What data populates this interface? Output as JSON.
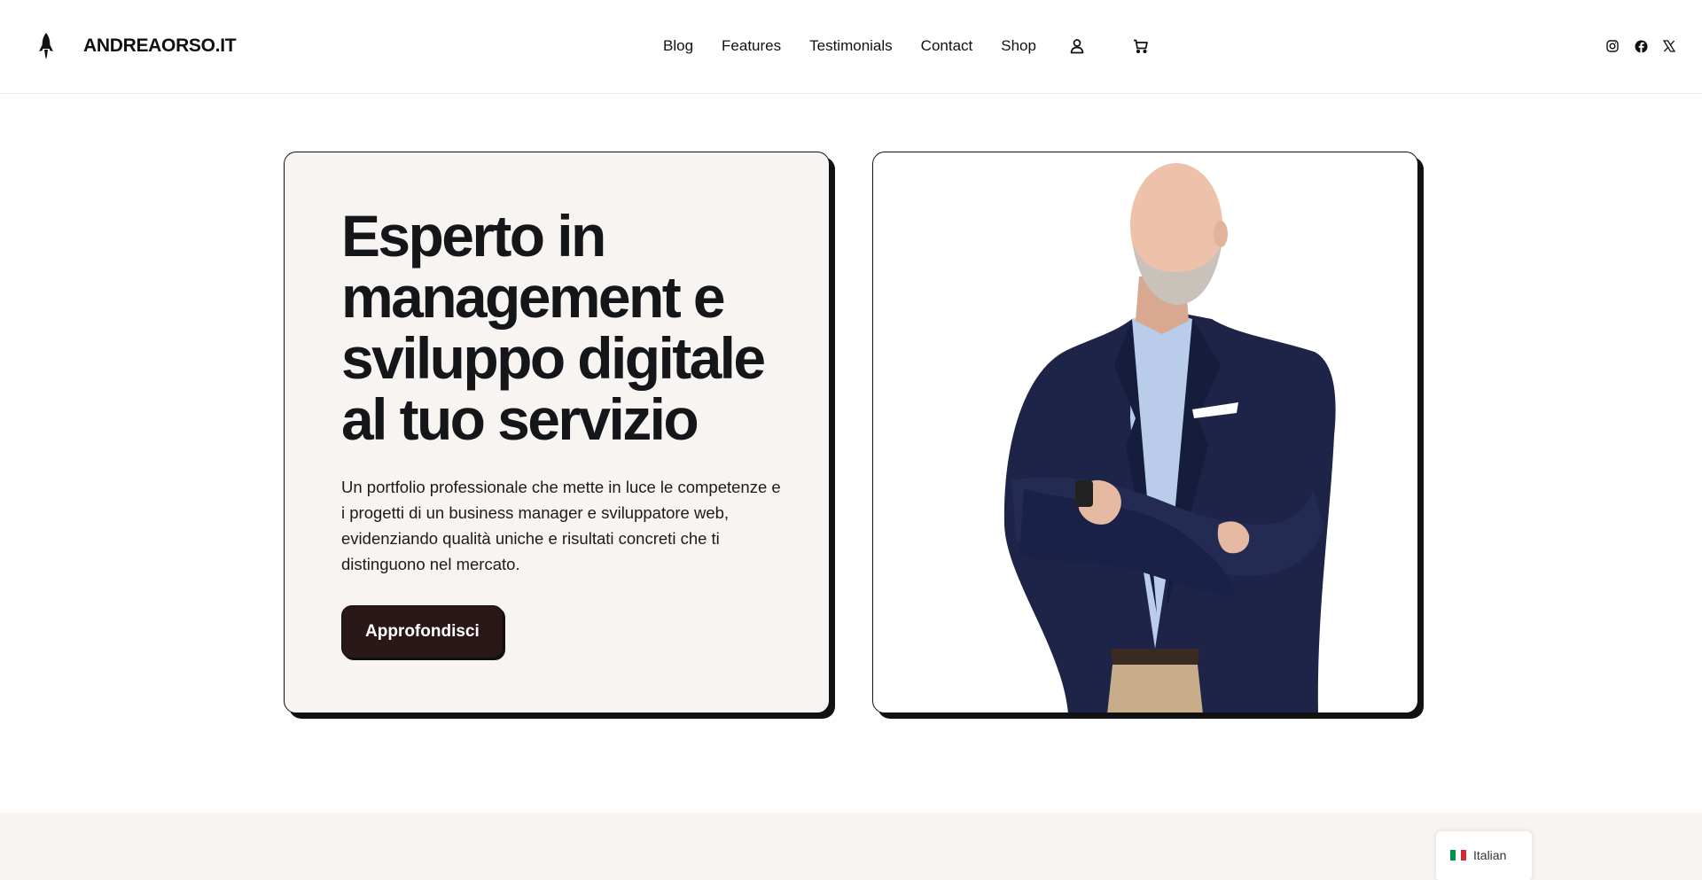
{
  "header": {
    "brand": "ANDREAORSO.IT",
    "nav": [
      "Blog",
      "Features",
      "Testimonials",
      "Contact",
      "Shop"
    ],
    "icons": [
      "user-icon",
      "cart-icon"
    ],
    "social": [
      "instagram-icon",
      "facebook-icon",
      "x-icon"
    ]
  },
  "hero": {
    "title_lines": [
      "Esperto in",
      "management e",
      "sviluppo digitale",
      "al tuo servizio"
    ],
    "description": "Un portfolio professionale che mette in luce le competenze e i progetti di un business manager e sviluppatore web, evidenziando qualità uniche e risultati concreti che ti distinguono nel mercato.",
    "cta_label": "Approfondisci",
    "image": "portrait-photo"
  },
  "language": {
    "label": "Italian",
    "flag_colors": [
      "#009246",
      "#ffffff",
      "#ce2b37"
    ]
  },
  "colors": {
    "card_bg": "#f7f4f1",
    "cta_bg": "#2a1718",
    "text": "#15161a"
  }
}
